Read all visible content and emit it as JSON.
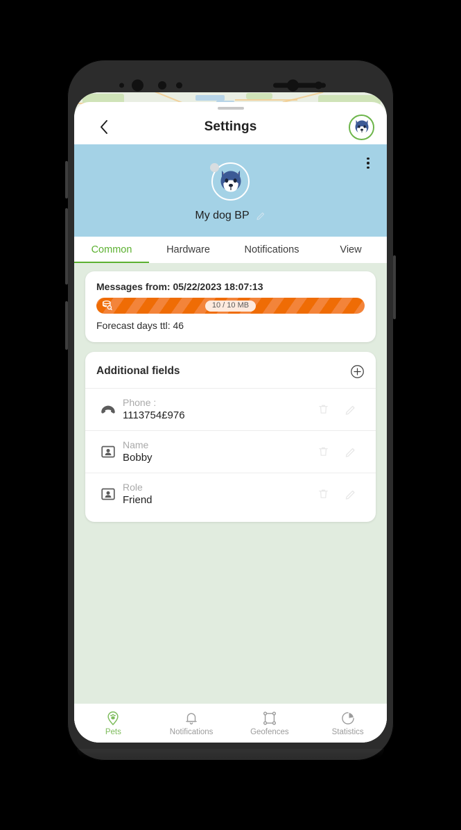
{
  "app": {
    "title": "Settings"
  },
  "header": {
    "back_icon": "chevron-left-icon",
    "avatar_icon": "dog-face-icon"
  },
  "pet_banner": {
    "name": "My dog BP",
    "edit_icon": "pencil-icon",
    "avatar_icon": "dog-face-icon",
    "status_dot_color": "#d8dde0",
    "background_color": "#a4d2e6",
    "overflow_icon": "more-vertical-icon"
  },
  "tabs": [
    {
      "label": "Common",
      "active": true
    },
    {
      "label": "Hardware",
      "active": false
    },
    {
      "label": "Notifications",
      "active": false
    },
    {
      "label": "View",
      "active": false
    }
  ],
  "storage_card": {
    "messages_from": "Messages from: 05/22/2023 18:07:13",
    "usage_badge": "10 / 10 MB",
    "forecast": "Forecast days ttl: 46",
    "bar_color": "#ef6c05",
    "bar_stripe_color": "#f3843a",
    "badge_background": "#fdeade",
    "storage_icon": "database-icon",
    "progress_percent": 100
  },
  "additional_fields": {
    "title": "Additional fields",
    "add_icon": "plus-circle-icon",
    "rows": [
      {
        "label": "Phone :",
        "value": "1113754£976",
        "icon": "phone-icon",
        "delete_icon": "trash-icon",
        "edit_icon": "pencil-icon"
      },
      {
        "label": "Name",
        "value": "Bobby",
        "icon": "contact-card-icon",
        "delete_icon": "trash-icon",
        "edit_icon": "pencil-icon"
      },
      {
        "label": "Role",
        "value": "Friend",
        "icon": "contact-card-icon",
        "delete_icon": "trash-icon",
        "edit_icon": "pencil-icon"
      }
    ]
  },
  "bottom_nav": [
    {
      "label": "Pets",
      "icon": "paw-pin-icon",
      "active": true
    },
    {
      "label": "Notifications",
      "icon": "bell-icon",
      "active": false
    },
    {
      "label": "Geofences",
      "icon": "geofence-square-icon",
      "active": false
    },
    {
      "label": "Statistics",
      "icon": "pie-chart-icon",
      "active": false
    }
  ],
  "theme": {
    "accent_green": "#5cb131",
    "nav_active_green": "#7cbb5a",
    "content_background": "#e1ecdf",
    "banner_blue": "#a4d2e6"
  }
}
